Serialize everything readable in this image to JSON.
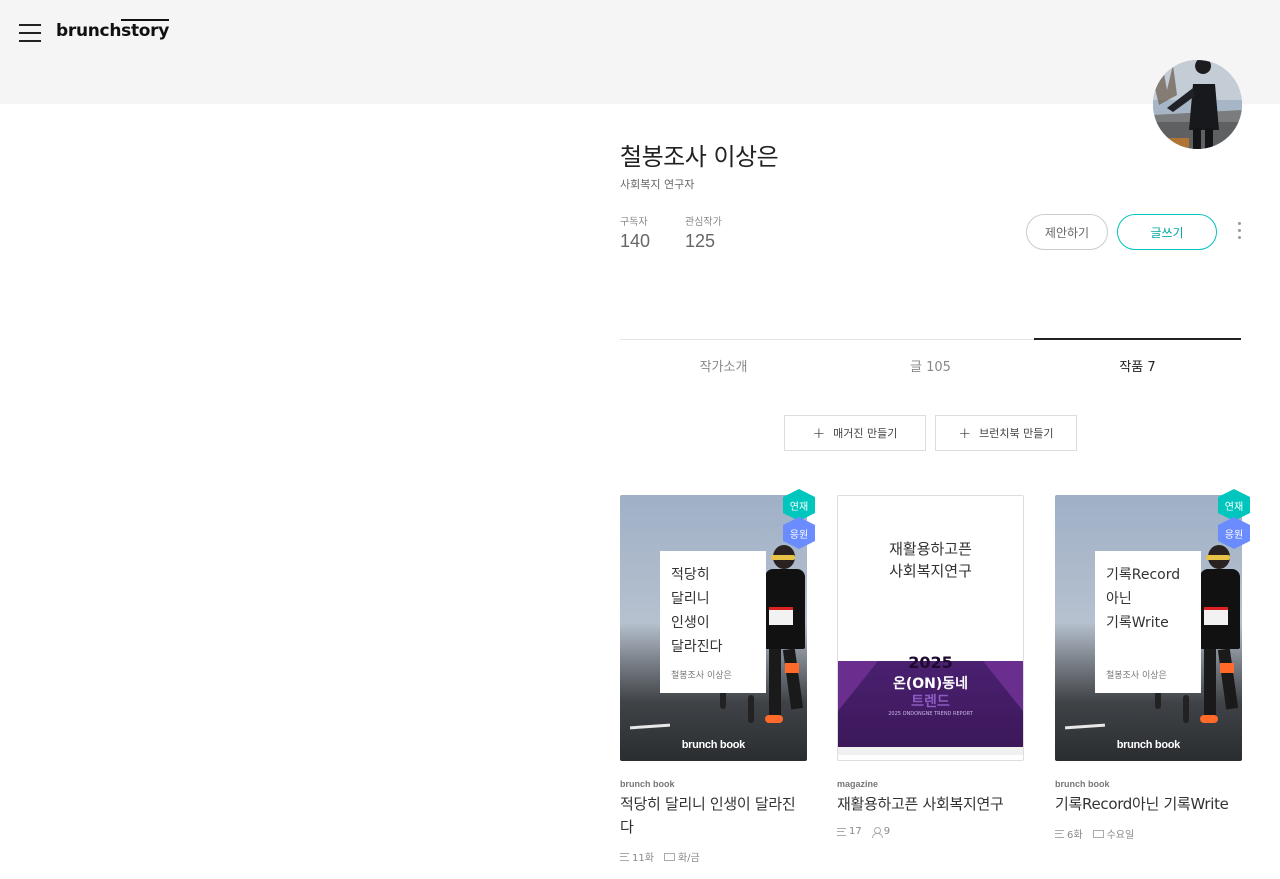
{
  "header": {
    "logo_main": "brunch",
    "logo_sub": "story"
  },
  "profile": {
    "name": "철봉조사 이상은",
    "description": "사회복지 연구자",
    "stats": [
      {
        "label": "구독자",
        "value": "140"
      },
      {
        "label": "관심작가",
        "value": "125"
      }
    ],
    "propose_label": "제안하기",
    "write_label": "글쓰기"
  },
  "tabs": [
    {
      "label": "작가소개",
      "active": false
    },
    {
      "label": "글 105",
      "active": false
    },
    {
      "label": "작품 7",
      "active": true
    }
  ],
  "actions": {
    "make_magazine": "매거진 만들기",
    "make_brunchbook": "브런치북 만들기"
  },
  "cards": [
    {
      "type": "brunch book",
      "title": "적당히 달리니 인생이 달라진다",
      "cover_title_lines": [
        "적당히",
        "달리니",
        "인생이",
        "달라진다"
      ],
      "cover_author": "철봉조사 이상은",
      "cover_mark": "brunch book",
      "badges": [
        "연재",
        "응원"
      ],
      "meta": [
        {
          "icon": "list-icon",
          "text": "11화"
        },
        {
          "icon": "calendar-icon",
          "text": "화/금"
        }
      ]
    },
    {
      "type": "magazine",
      "title": "재활용하고픈 사회복지연구",
      "cover_title_lines": [
        "재활용하고픈",
        "사회복지연구"
      ],
      "cover_image_text": {
        "year": "2025",
        "main": "온(ON)동네",
        "sub": "트렌드",
        "report": "2025 ONDONGNE TREND REPORT"
      },
      "meta": [
        {
          "icon": "list-icon",
          "text": "17"
        },
        {
          "icon": "user-icon",
          "text": "9"
        }
      ]
    },
    {
      "type": "brunch book",
      "title": "기록Record아닌 기록Write",
      "cover_title_lines": [
        "기록Record",
        "아닌",
        "기록Write"
      ],
      "cover_author": "철봉조사 이상은",
      "cover_mark": "brunch book",
      "badges": [
        "연재",
        "응원"
      ],
      "meta": [
        {
          "icon": "list-icon",
          "text": "6화"
        },
        {
          "icon": "calendar-icon",
          "text": "수요일"
        }
      ]
    }
  ],
  "colors": {
    "accent": "#00c3bd",
    "badge_serial": "#00c6be",
    "badge_support": "#6b8cff",
    "header_bg": "#f5f5f5"
  }
}
